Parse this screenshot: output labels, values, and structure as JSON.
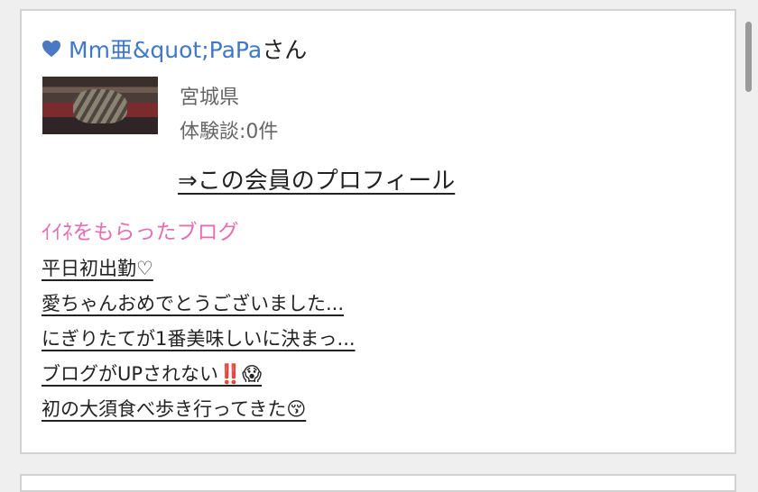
{
  "member": {
    "heart_icon": "heart-icon",
    "name": "Mm亜&quot;PaPa",
    "suffix": "さん",
    "prefecture": "宮城県",
    "experience_count": "体験談:0件",
    "profile_link": "⇒この会員のプロフィール"
  },
  "blog_section": {
    "title": "ｲｲﾈをもらったブログ",
    "items": [
      {
        "label": "平日初出勤♡"
      },
      {
        "label": "愛ちゃんおめでとうございました..."
      },
      {
        "label": "にぎりたてが1番美味しいに決まっ..."
      },
      {
        "label": "ブログがUPされない‼️😱"
      },
      {
        "label": "初の大須食べ歩き行ってきた😚"
      }
    ]
  },
  "colors": {
    "name_blue": "#3f78c8",
    "section_pink": "#e56db0"
  }
}
